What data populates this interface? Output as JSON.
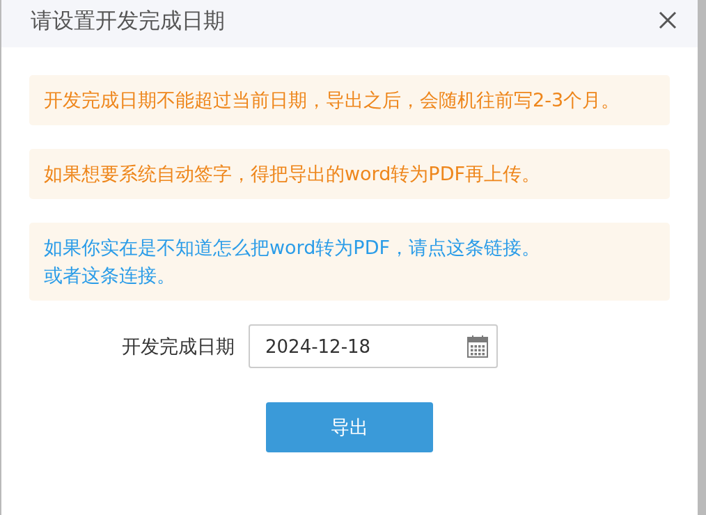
{
  "dialog": {
    "title": "请设置开发完成日期"
  },
  "notices": [
    {
      "kind": "warning",
      "lines": [
        "开发完成日期不能超过当前日期，导出之后，会随机往前写2-3个月。"
      ]
    },
    {
      "kind": "warning",
      "lines": [
        "如果想要系统自动签字，得把导出的word转为PDF再上传。"
      ]
    },
    {
      "kind": "info",
      "lines": [
        "如果你实在是不知道怎么把word转为PDF，请点这条链接。",
        "或者这条连接。"
      ]
    }
  ],
  "form": {
    "label": "开发完成日期",
    "date_value": "2024-12-18"
  },
  "buttons": [
    {
      "label": "导出"
    }
  ]
}
